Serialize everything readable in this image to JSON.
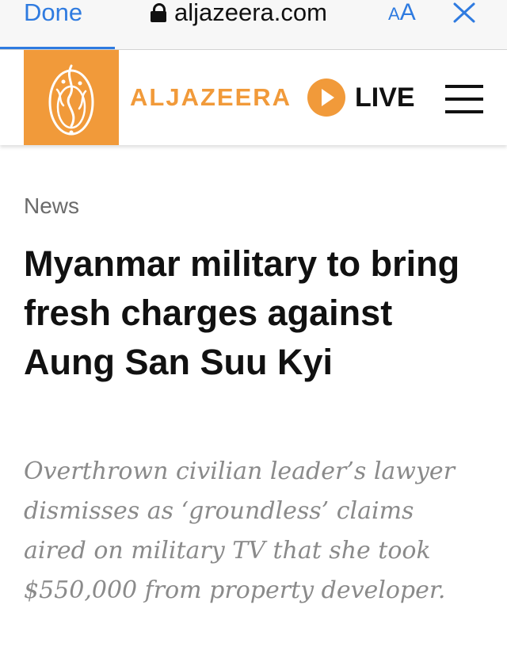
{
  "browser": {
    "done_label": "Done",
    "domain": "aljazeera.com",
    "text_size_small": "A",
    "text_size_large": "A",
    "accent_color": "#2f7be0"
  },
  "header": {
    "brand": "ALJAZEERA",
    "live_label": "LIVE",
    "brand_color": "#f19a3a",
    "icons": [
      "aljazeera-logo-icon",
      "play-icon",
      "menu-icon"
    ]
  },
  "article": {
    "category": "News",
    "headline": "Myanmar military to bring fresh charges against Aung San Suu Kyi",
    "standfirst": "Overthrown civilian leader’s lawyer dismisses as ‘groundless’ claims aired on military TV that she took $550,000 from property developer."
  }
}
